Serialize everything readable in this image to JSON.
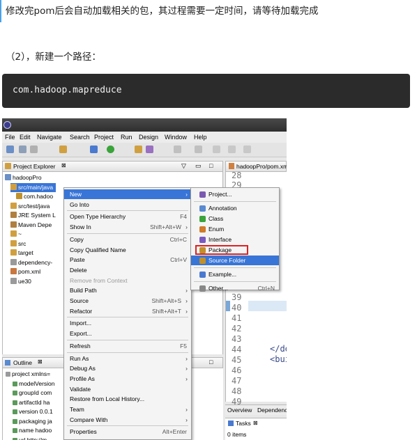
{
  "intro_text": "修改完pom后会自动加载相关的包，其过程需要一定时间，请等待加载完成",
  "step_text": "（2），新建一个路径：",
  "code_block": "com.hadoop.mapreduce",
  "eclipse": {
    "menu": [
      "File",
      "Edit",
      "Navigate",
      "Search",
      "Project",
      "Run",
      "Design",
      "Window",
      "Help"
    ],
    "project_explorer_title": "Project Explorer",
    "tree": [
      {
        "label": "hadoopPro",
        "selected": false,
        "indent": 0
      },
      {
        "label": "src/main/java",
        "selected": true,
        "indent": 1
      },
      {
        "label": "com.hadoo",
        "selected": false,
        "indent": 2
      },
      {
        "label": "src/test/java",
        "selected": false,
        "indent": 1
      },
      {
        "label": "JRE System L",
        "selected": false,
        "indent": 1
      },
      {
        "label": "Maven Depe",
        "selected": false,
        "indent": 1
      },
      {
        "label": "~",
        "selected": false,
        "indent": 1
      },
      {
        "label": "src",
        "selected": false,
        "indent": 1
      },
      {
        "label": "target",
        "selected": false,
        "indent": 1
      },
      {
        "label": "dependency-",
        "selected": false,
        "indent": 1
      },
      {
        "label": "pom.xml",
        "selected": false,
        "indent": 1
      },
      {
        "label": "ue30",
        "selected": false,
        "indent": 1
      }
    ],
    "editor_tab": "hadoopPro/pom.xm",
    "line_numbers": [
      "28",
      "29",
      "39",
      "40",
      "41",
      "42",
      "43",
      "44",
      "45",
      "46",
      "47",
      "48",
      "49"
    ],
    "editor_code": {
      "l44": "</de",
      "l45": "<bui"
    },
    "context_menu": [
      {
        "label": "New",
        "shortcut": "",
        "arrow": true,
        "highlight": true
      },
      {
        "label": "Go Into",
        "shortcut": "",
        "arrow": false
      },
      {
        "sep": true
      },
      {
        "label": "Open Type Hierarchy",
        "shortcut": "F4",
        "arrow": false
      },
      {
        "label": "Show In",
        "shortcut": "Shift+Alt+W",
        "arrow": true
      },
      {
        "sep": true
      },
      {
        "label": "Copy",
        "shortcut": "Ctrl+C",
        "arrow": false
      },
      {
        "label": "Copy Qualified Name",
        "shortcut": "",
        "arrow": false
      },
      {
        "label": "Paste",
        "shortcut": "Ctrl+V",
        "arrow": false
      },
      {
        "label": "Delete",
        "shortcut": "",
        "arrow": false
      },
      {
        "label": "Remove from Context",
        "shortcut": "",
        "arrow": false,
        "disabled": true
      },
      {
        "label": "Build Path",
        "shortcut": "",
        "arrow": true
      },
      {
        "label": "Source",
        "shortcut": "Shift+Alt+S",
        "arrow": true
      },
      {
        "label": "Refactor",
        "shortcut": "Shift+Alt+T",
        "arrow": true
      },
      {
        "sep": true
      },
      {
        "label": "Import...",
        "shortcut": "",
        "arrow": false
      },
      {
        "label": "Export...",
        "shortcut": "",
        "arrow": false
      },
      {
        "sep": true
      },
      {
        "label": "Refresh",
        "shortcut": "F5",
        "arrow": false
      },
      {
        "sep": true
      },
      {
        "label": "Run As",
        "shortcut": "",
        "arrow": true
      },
      {
        "label": "Debug As",
        "shortcut": "",
        "arrow": true
      },
      {
        "label": "Profile As",
        "shortcut": "",
        "arrow": true
      },
      {
        "label": "Validate",
        "shortcut": "",
        "arrow": false
      },
      {
        "label": "Restore from Local History...",
        "shortcut": "",
        "arrow": false
      },
      {
        "label": "Team",
        "shortcut": "",
        "arrow": true
      },
      {
        "label": "Compare With",
        "shortcut": "",
        "arrow": true
      },
      {
        "sep": true
      },
      {
        "label": "Properties",
        "shortcut": "Alt+Enter",
        "arrow": false
      }
    ],
    "submenu": [
      {
        "label": "Project...",
        "shortcut": "",
        "color": "#7a5ab0"
      },
      {
        "sep": true
      },
      {
        "label": "Annotation",
        "shortcut": "",
        "color": "#5a8ad0"
      },
      {
        "label": "Class",
        "shortcut": "",
        "color": "#3aa33a"
      },
      {
        "label": "Enum",
        "shortcut": "",
        "color": "#d07a2a"
      },
      {
        "label": "Interface",
        "shortcut": "",
        "color": "#7a5ac0"
      },
      {
        "label": "Package",
        "shortcut": "",
        "color": "#c0902a",
        "boxed": true
      },
      {
        "label": "Source Folder",
        "shortcut": "",
        "color": "#c0902a",
        "highlight": true
      },
      {
        "sep": true
      },
      {
        "label": "Example...",
        "shortcut": "",
        "color": "#4a7ad0"
      },
      {
        "sep": true
      },
      {
        "label": "Other...",
        "shortcut": "Ctrl+N",
        "color": "#888888"
      }
    ],
    "outline_title": "Outline",
    "outline_rows": [
      "project xmlns=",
      "modelVersion",
      "groupId  com",
      "artifactId  ha",
      "version  0.0.1",
      "packaging  ja",
      "name  hadoo",
      "url  http://m"
    ],
    "bottom_tabs": [
      "Overview",
      "Dependenc"
    ],
    "tasks_title": "Tasks",
    "tasks_count": "0 items"
  }
}
